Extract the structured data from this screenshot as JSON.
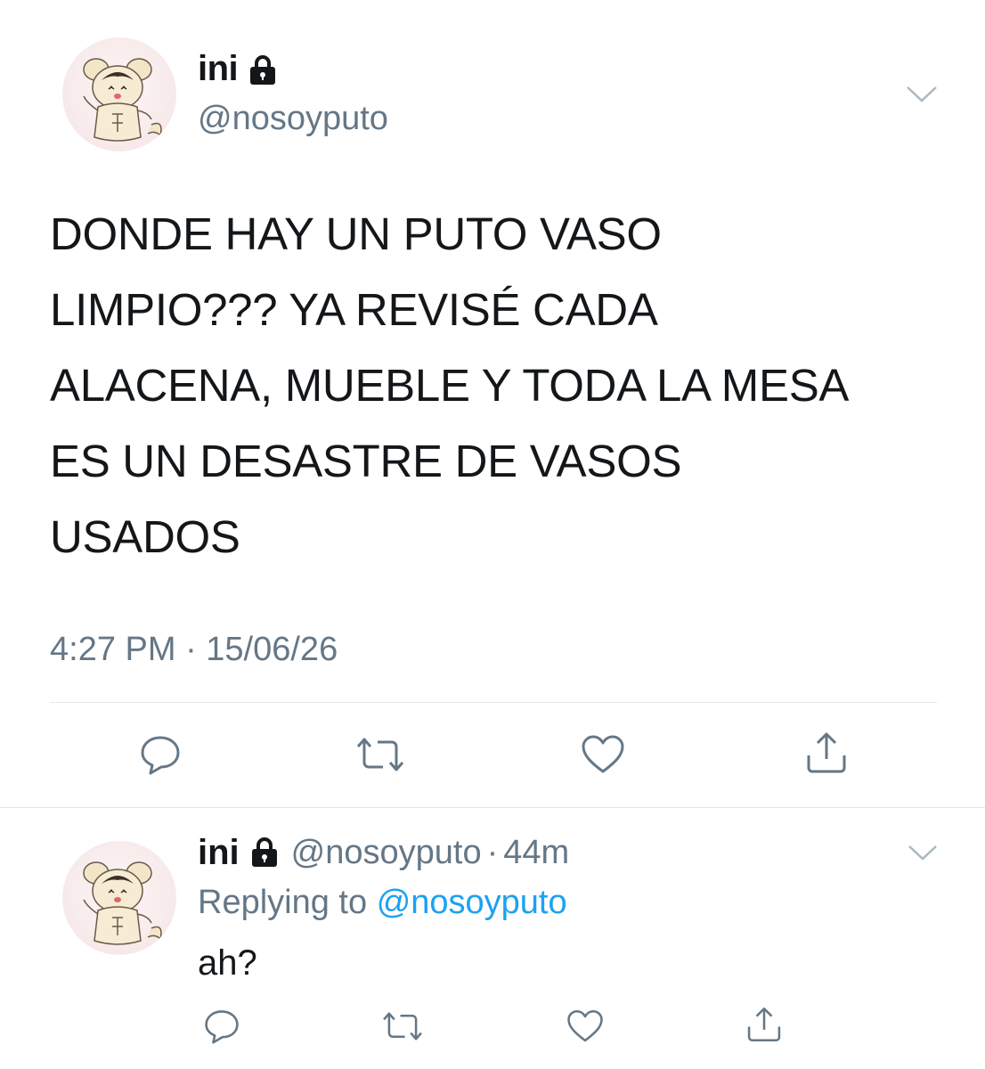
{
  "main_tweet": {
    "display_name": "ini",
    "handle": "@nosoyputo",
    "text": "DONDE HAY UN PUTO VASO\nLIMPIO??? YA REVISÉ CADA\nALACENA, MUEBLE Y TODA LA MESA\nES UN DESASTRE DE VASOS\nUSADOS",
    "timestamp": "4:27 PM · 15/06/26"
  },
  "reply": {
    "display_name": "ini",
    "handle": "@nosoyputo",
    "separator": "·",
    "age": "44m",
    "replying_prefix": "Replying to",
    "replying_handle": "@nosoyputo",
    "text": "ah?"
  },
  "colors": {
    "text": "#14171a",
    "secondary": "#657786",
    "link": "#1da1f2",
    "divider": "#e1e8ed"
  },
  "icons": [
    "lock-icon",
    "chevron-down-icon",
    "reply-icon",
    "retweet-icon",
    "like-icon",
    "share-icon"
  ]
}
